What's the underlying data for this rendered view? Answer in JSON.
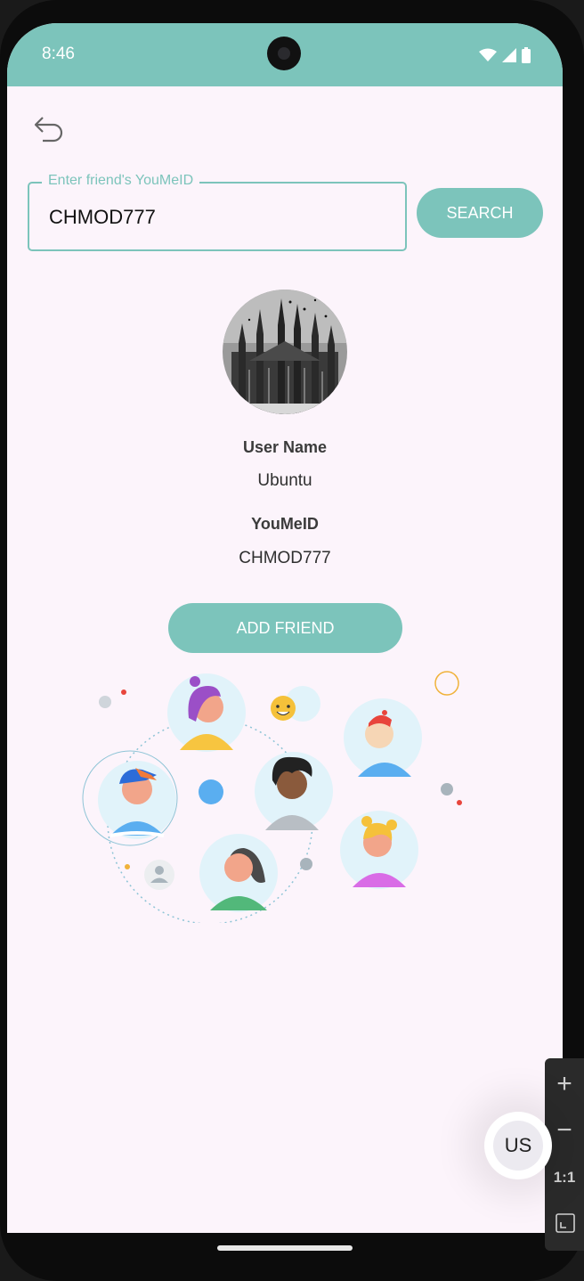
{
  "status_bar": {
    "time": "8:46"
  },
  "search": {
    "label": "Enter friend's YouMeID",
    "value": "CHMOD777",
    "button_label": "SEARCH"
  },
  "profile": {
    "user_name_label": "User Name",
    "user_name_value": "Ubuntu",
    "youmeid_label": "YouMeID",
    "youmeid_value": "CHMOD777"
  },
  "add_friend_label": "ADD FRIEND",
  "fab_label": "US",
  "zoom_controls": {
    "ratio_label": "1:1"
  },
  "colors": {
    "accent": "#7cc4bb",
    "background": "#fcf4fb"
  }
}
